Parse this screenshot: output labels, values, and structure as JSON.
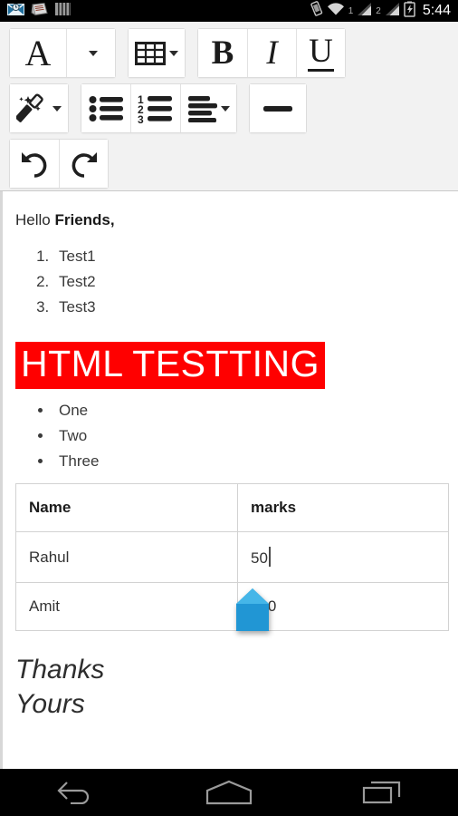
{
  "statusbar": {
    "icons": [
      "email-icon",
      "news-icon",
      "barcode-icon"
    ],
    "right_icons": [
      "vibrate-icon",
      "wifi-icon",
      "signal-sim1-icon",
      "signal-sim2-icon",
      "battery-charging-icon"
    ],
    "sim1_label": "1",
    "sim2_label": "2",
    "time": "5:44"
  },
  "toolbar": {
    "rows": [
      {
        "groups": [
          {
            "buttons": [
              {
                "name": "font-face-button",
                "glyph": "A",
                "style": "serif"
              },
              {
                "name": "font-face-dropdown-button",
                "glyph": "",
                "style": "caret"
              }
            ]
          },
          {
            "buttons": [
              {
                "name": "table-insert-button",
                "glyph": "table-icon",
                "style": "icon-caret"
              }
            ]
          },
          {
            "buttons": [
              {
                "name": "bold-button",
                "glyph": "B",
                "style": "bold"
              },
              {
                "name": "italic-button",
                "glyph": "I",
                "style": "italic"
              },
              {
                "name": "underline-button",
                "glyph": "U",
                "style": "underline"
              }
            ]
          }
        ]
      },
      {
        "groups": [
          {
            "buttons": [
              {
                "name": "text-style-magic-button",
                "glyph": "magic-wand-icon",
                "style": "icon-caret"
              }
            ]
          },
          {
            "buttons": [
              {
                "name": "bullet-list-button",
                "glyph": "bullet-list-icon",
                "style": "icon"
              },
              {
                "name": "numbered-list-button",
                "glyph": "numbered-list-icon",
                "style": "icon"
              },
              {
                "name": "align-button",
                "glyph": "align-left-icon",
                "style": "icon-caret"
              }
            ]
          },
          {
            "buttons": [
              {
                "name": "horizontal-rule-button",
                "glyph": "horizontal-rule-icon",
                "style": "icon"
              }
            ]
          }
        ]
      },
      {
        "groups": [
          {
            "buttons": [
              {
                "name": "undo-button",
                "glyph": "undo-icon",
                "style": "icon"
              },
              {
                "name": "redo-button",
                "glyph": "redo-icon",
                "style": "icon"
              }
            ]
          }
        ]
      }
    ]
  },
  "document": {
    "greeting_prefix": "Hello ",
    "greeting_bold": "Friends,",
    "numbered_list": [
      "Test1",
      "Test2",
      "Test3"
    ],
    "banner_text": "HTML TESTTING",
    "banner_bg": "#FF0000",
    "banner_color": "#FFFFFF",
    "bullet_list": [
      "One",
      "Two",
      "Three"
    ],
    "table": {
      "headers": [
        "Name",
        "marks"
      ],
      "rows": [
        [
          "Rahul",
          "50"
        ],
        [
          "Amit",
          "100"
        ]
      ]
    },
    "signoff": [
      "Thanks",
      "Yours"
    ]
  },
  "selection_handle": {
    "name": "text-cursor-handle",
    "color": "#2196d4"
  },
  "navbar": {
    "buttons": [
      {
        "name": "nav-back-button",
        "icon": "back-arrow-icon"
      },
      {
        "name": "nav-home-button",
        "icon": "home-icon"
      },
      {
        "name": "nav-recents-button",
        "icon": "recents-icon"
      }
    ]
  }
}
